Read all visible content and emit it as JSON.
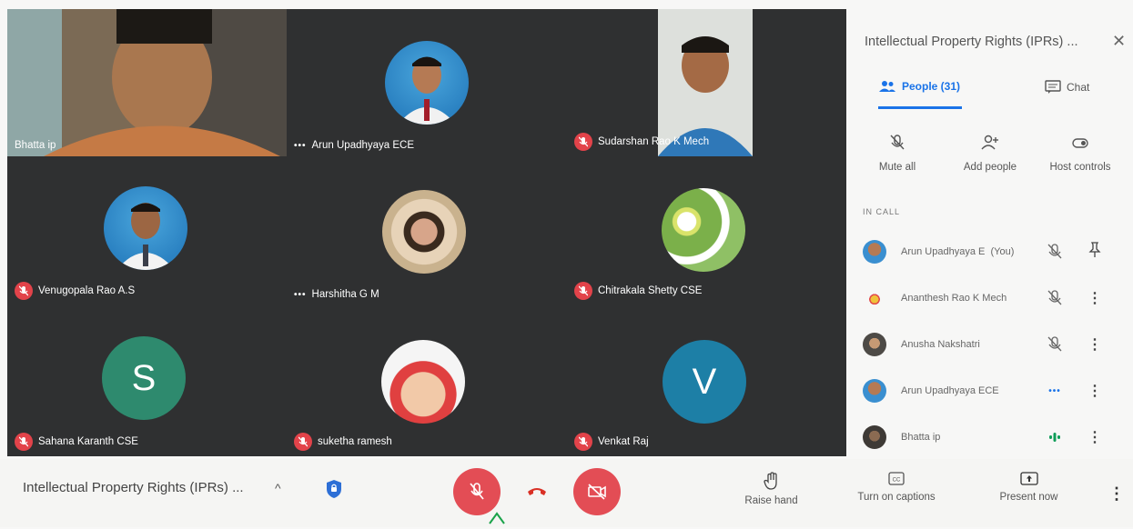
{
  "panel": {
    "title": "Intellectual Property Rights (IPRs) ...",
    "tabs": {
      "people": "People (31)",
      "chat": "Chat"
    },
    "actions": {
      "mute_all": "Mute all",
      "add_people": "Add people",
      "host_controls": "Host controls"
    },
    "section_label": "IN CALL",
    "participants": [
      {
        "name": "Arun Upadhyaya E",
        "suffix": "(You)",
        "status": "mic-off",
        "action": "pin"
      },
      {
        "name": "Ananthesh Rao K Mech",
        "status": "mic-off",
        "action": "more"
      },
      {
        "name": "Anusha Nakshatri",
        "status": "mic-off",
        "action": "more"
      },
      {
        "name": "Arun Upadhyaya ECE",
        "status": "dots",
        "action": "more"
      },
      {
        "name": "Bhatta ip",
        "status": "speaking",
        "action": "more"
      }
    ]
  },
  "tiles": [
    {
      "name": "Bhatta ip",
      "indicator": "none",
      "kind": "video"
    },
    {
      "name": "Arun Upadhyaya ECE",
      "indicator": "dots",
      "kind": "avatar"
    },
    {
      "name": "Sudarshan Rao K Mech",
      "indicator": "mic-off",
      "kind": "video"
    },
    {
      "name": "Venugopala Rao A.S",
      "indicator": "mic-off",
      "kind": "avatar"
    },
    {
      "name": "Harshitha G M",
      "indicator": "dots",
      "kind": "avatar"
    },
    {
      "name": "Chitrakala Shetty CSE",
      "indicator": "mic-off",
      "kind": "avatar"
    },
    {
      "name": "Sahana Karanth CSE",
      "indicator": "mic-off",
      "kind": "letter",
      "letter": "S"
    },
    {
      "name": "suketha ramesh",
      "indicator": "mic-off",
      "kind": "avatar"
    },
    {
      "name": "Venkat Raj",
      "indicator": "mic-off",
      "kind": "letter",
      "letter": "V"
    }
  ],
  "bottom_bar": {
    "meeting_title": "Intellectual Property Rights (IPRs) ...",
    "raise_hand": "Raise hand",
    "captions": "Turn on captions",
    "present": "Present now"
  },
  "colors": {
    "accent": "#1a73e8",
    "danger": "#e34d55",
    "tile_bg": "#2f3031"
  }
}
